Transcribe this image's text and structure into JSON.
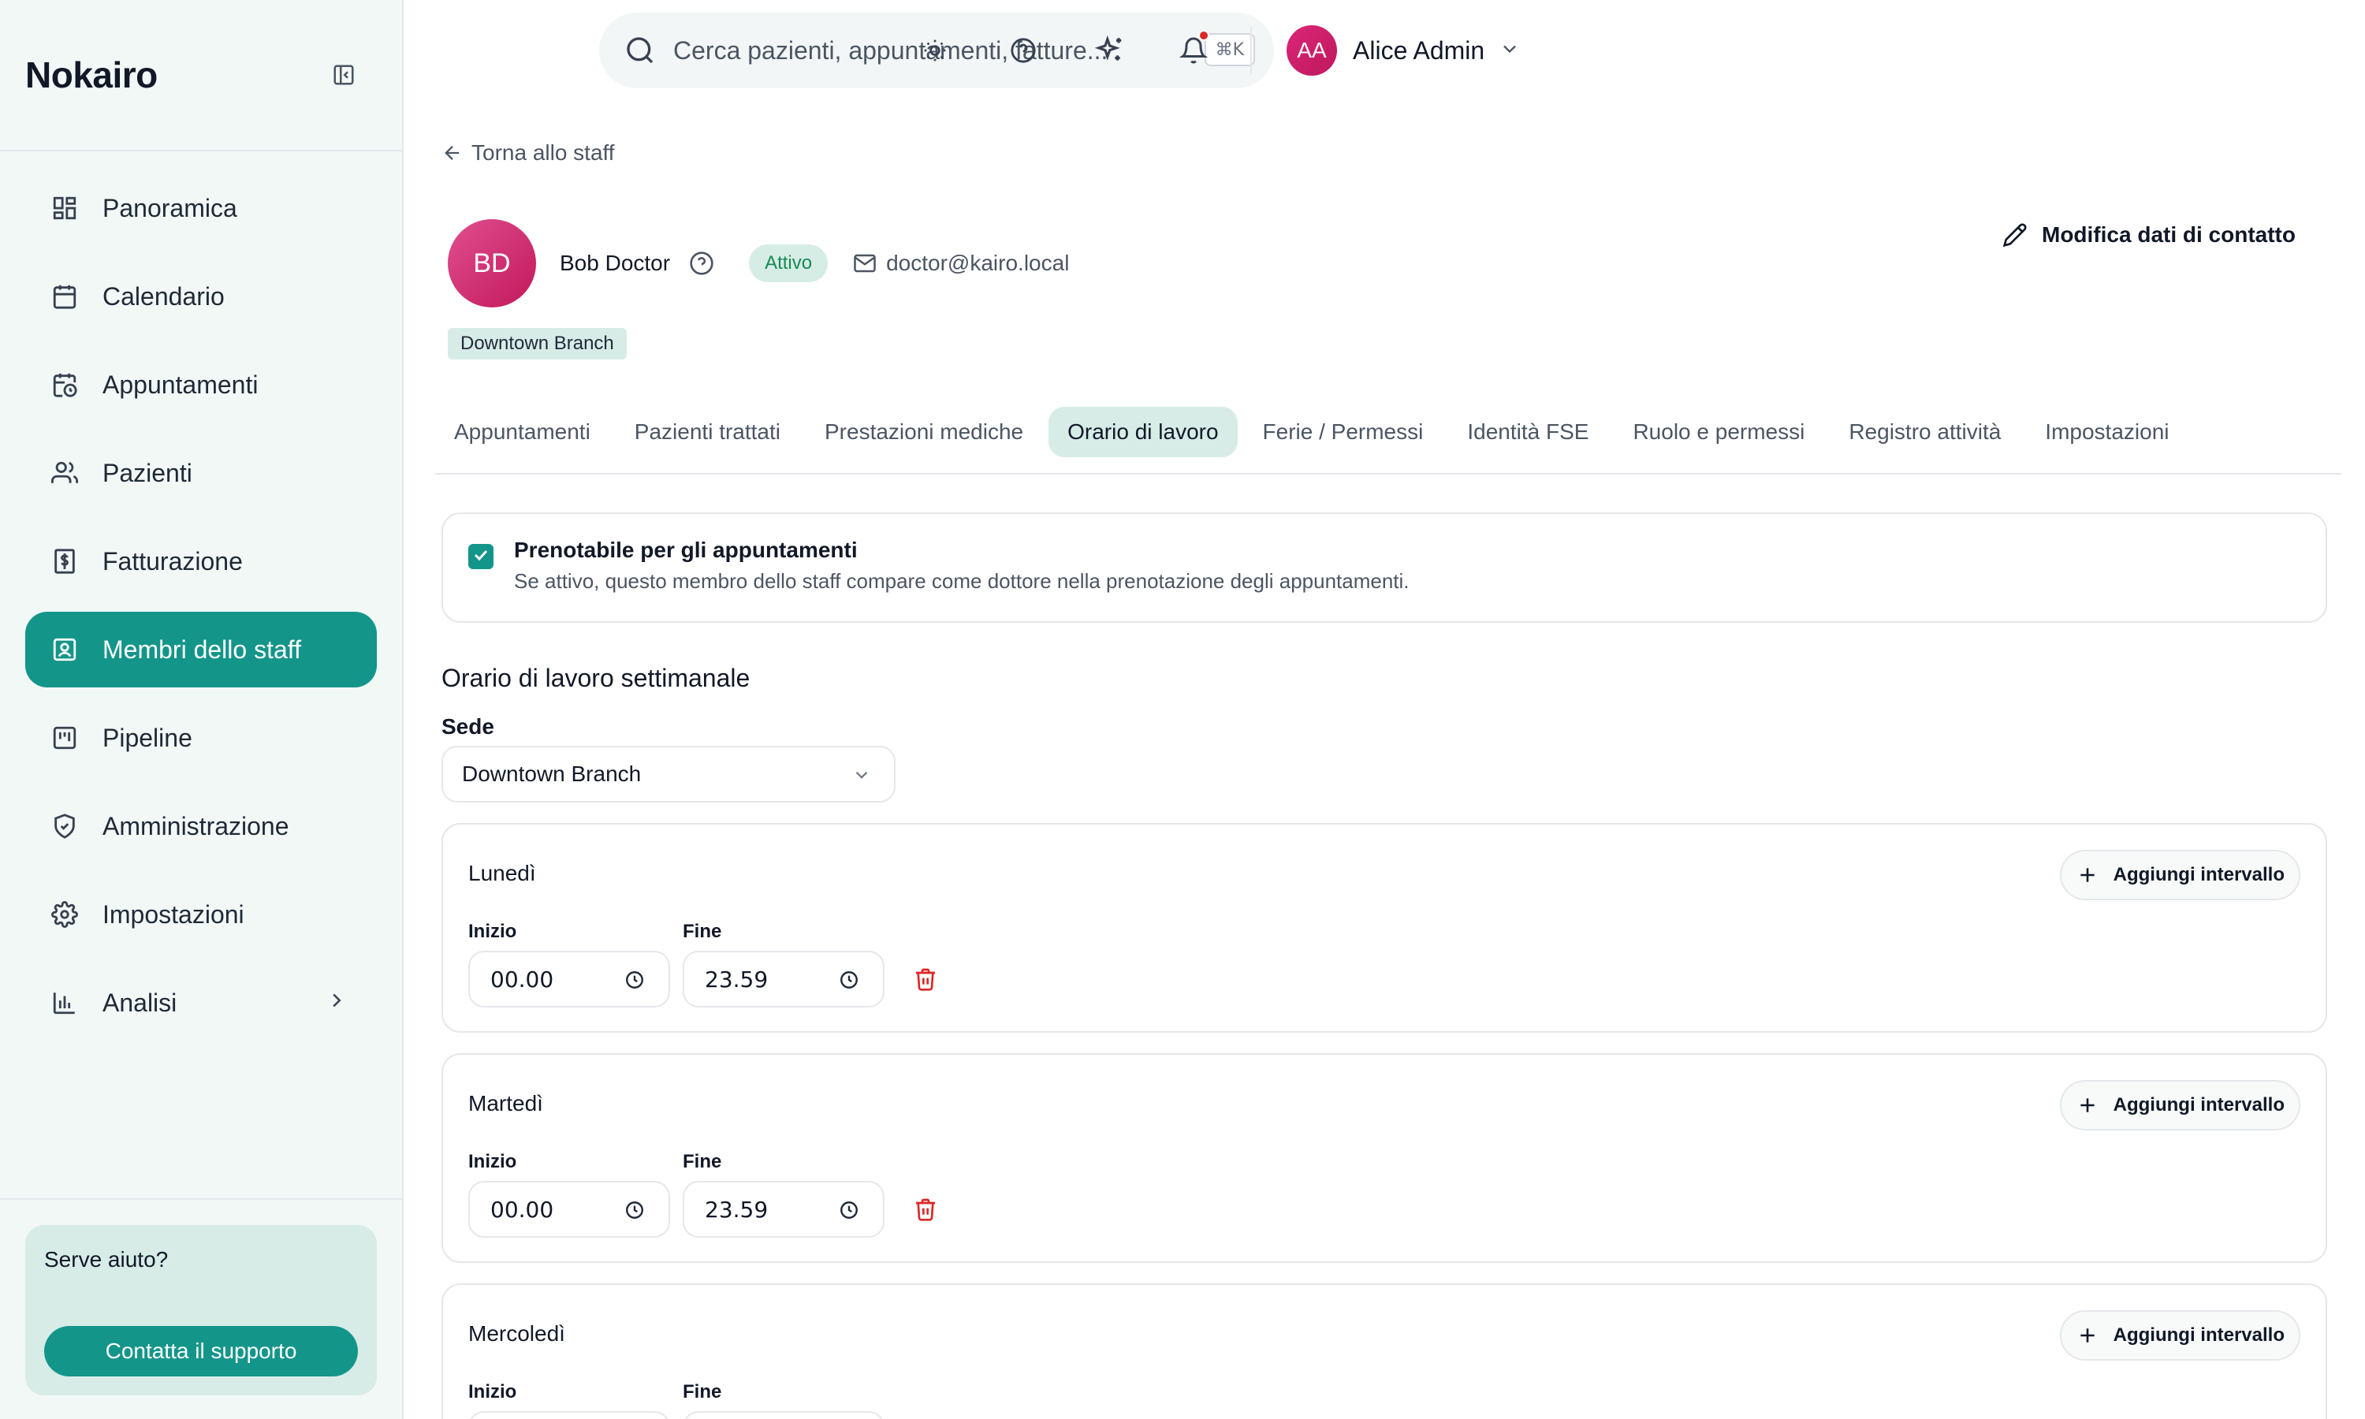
{
  "app": {
    "name": "Nokairo"
  },
  "sidebar": {
    "items": [
      {
        "label": "Panoramica",
        "icon": "dashboard-icon"
      },
      {
        "label": "Calendario",
        "icon": "calendar-icon"
      },
      {
        "label": "Appuntamenti",
        "icon": "calendar-clock-icon"
      },
      {
        "label": "Pazienti",
        "icon": "users-icon"
      },
      {
        "label": "Fatturazione",
        "icon": "invoice-icon"
      },
      {
        "label": "Membri dello staff",
        "icon": "staff-badge-icon",
        "active": true
      },
      {
        "label": "Pipeline",
        "icon": "kanban-icon"
      },
      {
        "label": "Amministrazione",
        "icon": "shield-icon"
      },
      {
        "label": "Impostazioni",
        "icon": "gear-icon"
      },
      {
        "label": "Analisi",
        "icon": "bar-chart-icon",
        "expandable": true
      }
    ],
    "help": {
      "title": "Serve aiuto?",
      "button": "Contatta il supporto"
    }
  },
  "topbar": {
    "search_placeholder": "Cerca pazienti, appuntamenti, fatture...",
    "shortcut": "⌘K",
    "user": {
      "initials": "AA",
      "name": "Alice Admin"
    },
    "has_notifications": true
  },
  "profile": {
    "back_label": "Torna allo staff",
    "initials": "BD",
    "name": "Bob Doctor",
    "status": "Attivo",
    "email": "doctor@kairo.local",
    "branch": "Downtown Branch",
    "edit_label": "Modifica dati di contatto"
  },
  "tabs": [
    {
      "label": "Appuntamenti"
    },
    {
      "label": "Pazienti trattati"
    },
    {
      "label": "Prestazioni mediche"
    },
    {
      "label": "Orario di lavoro",
      "active": true
    },
    {
      "label": "Ferie / Permessi"
    },
    {
      "label": "Identità FSE"
    },
    {
      "label": "Ruolo e permessi"
    },
    {
      "label": "Registro attività"
    },
    {
      "label": "Impostazioni"
    }
  ],
  "bookable": {
    "checked": true,
    "title": "Prenotabile per gli appuntamenti",
    "description": "Se attivo, questo membro dello staff compare come dottore nella prenotazione degli appuntamenti."
  },
  "schedule": {
    "title": "Orario di lavoro settimanale",
    "location_label": "Sede",
    "location_value": "Downtown Branch",
    "add_interval_label": "Aggiungi intervallo",
    "start_label": "Inizio",
    "end_label": "Fine",
    "days": [
      {
        "name": "Lunedì",
        "start": "00.00",
        "end": "23.59"
      },
      {
        "name": "Martedì",
        "start": "00.00",
        "end": "23.59"
      },
      {
        "name": "Mercoledì",
        "start": "",
        "end": ""
      }
    ]
  },
  "colors": {
    "accent": "#14958a",
    "accent_soft": "#d7ece7",
    "sidebar_bg": "#f1f8f6",
    "danger": "#dc2626",
    "status_green": "#168a55"
  }
}
